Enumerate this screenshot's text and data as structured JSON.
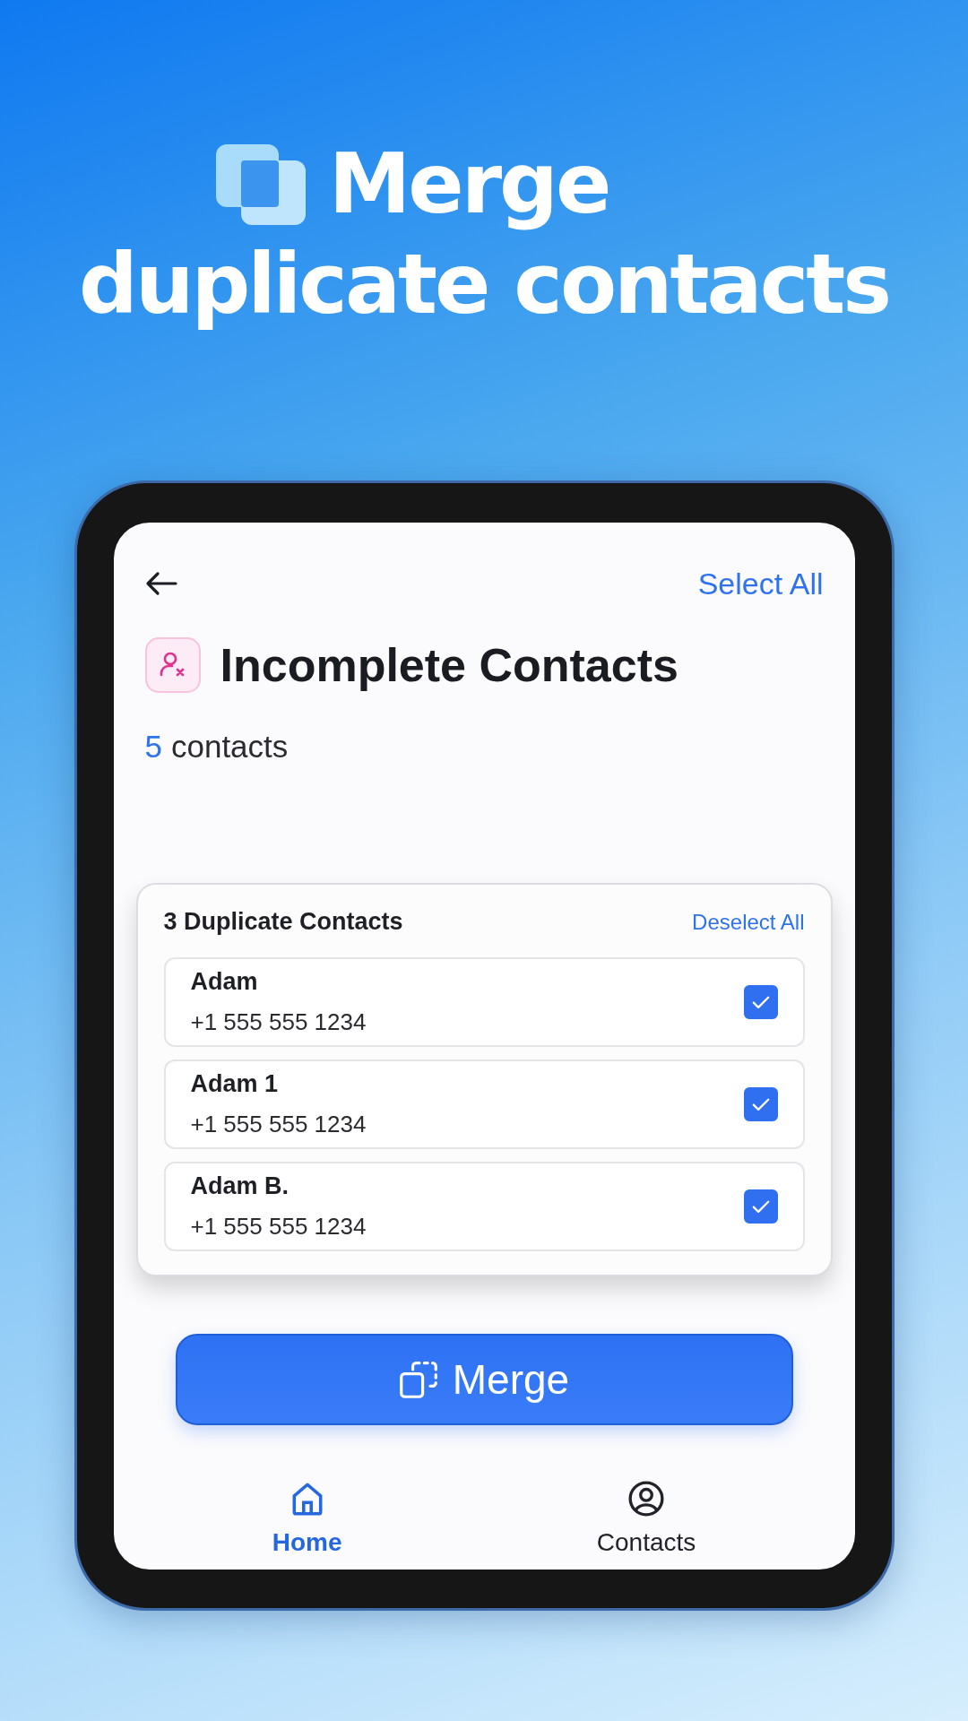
{
  "headline": {
    "title": "Merge",
    "subtitle": "duplicate contacts"
  },
  "screen": {
    "select_all": "Select All",
    "title": "Incomplete Contacts",
    "count": "5",
    "count_label": "contacts",
    "group": {
      "title": "3 Duplicate Contacts",
      "deselect_all": "Deselect All",
      "contacts": [
        {
          "name": "Adam",
          "phone": "+1 555 555 1234",
          "checked": true
        },
        {
          "name": "Adam 1",
          "phone": "+1 555 555 1234",
          "checked": true
        },
        {
          "name": "Adam B.",
          "phone": "+1 555 555 1234",
          "checked": true
        }
      ]
    },
    "merge_button": "Merge",
    "nav": [
      {
        "label": "Home",
        "kind": "home",
        "selected": true
      },
      {
        "label": "Contacts",
        "kind": "contacts",
        "selected": false
      }
    ]
  }
}
